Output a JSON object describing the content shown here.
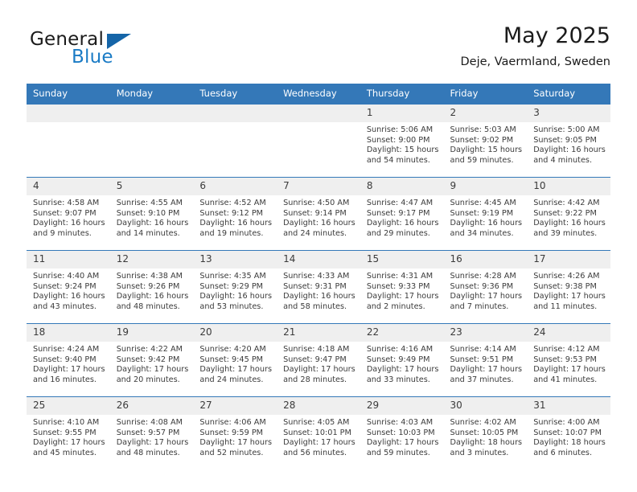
{
  "brand": {
    "name_part1": "General",
    "name_part2": "Blue",
    "logo_icon": "triangle-logo-icon",
    "accent_color": "#1a7bc5"
  },
  "header": {
    "title": "May 2025",
    "subtitle": "Deje, Vaermland, Sweden"
  },
  "theme": {
    "header_blue": "#3478b8",
    "daynum_gray": "#efefef",
    "text_color": "#3b3b3b"
  },
  "calendar": {
    "weekday_headers": [
      "Sunday",
      "Monday",
      "Tuesday",
      "Wednesday",
      "Thursday",
      "Friday",
      "Saturday"
    ],
    "weeks": [
      [
        {
          "day": "",
          "sunrise": "",
          "sunset": "",
          "daylight_line1": "",
          "daylight_line2": "",
          "empty": true
        },
        {
          "day": "",
          "sunrise": "",
          "sunset": "",
          "daylight_line1": "",
          "daylight_line2": "",
          "empty": true
        },
        {
          "day": "",
          "sunrise": "",
          "sunset": "",
          "daylight_line1": "",
          "daylight_line2": "",
          "empty": true
        },
        {
          "day": "",
          "sunrise": "",
          "sunset": "",
          "daylight_line1": "",
          "daylight_line2": "",
          "empty": true
        },
        {
          "day": "1",
          "sunrise": "Sunrise: 5:06 AM",
          "sunset": "Sunset: 9:00 PM",
          "daylight_line1": "Daylight: 15 hours",
          "daylight_line2": "and 54 minutes."
        },
        {
          "day": "2",
          "sunrise": "Sunrise: 5:03 AM",
          "sunset": "Sunset: 9:02 PM",
          "daylight_line1": "Daylight: 15 hours",
          "daylight_line2": "and 59 minutes."
        },
        {
          "day": "3",
          "sunrise": "Sunrise: 5:00 AM",
          "sunset": "Sunset: 9:05 PM",
          "daylight_line1": "Daylight: 16 hours",
          "daylight_line2": "and 4 minutes."
        }
      ],
      [
        {
          "day": "4",
          "sunrise": "Sunrise: 4:58 AM",
          "sunset": "Sunset: 9:07 PM",
          "daylight_line1": "Daylight: 16 hours",
          "daylight_line2": "and 9 minutes."
        },
        {
          "day": "5",
          "sunrise": "Sunrise: 4:55 AM",
          "sunset": "Sunset: 9:10 PM",
          "daylight_line1": "Daylight: 16 hours",
          "daylight_line2": "and 14 minutes."
        },
        {
          "day": "6",
          "sunrise": "Sunrise: 4:52 AM",
          "sunset": "Sunset: 9:12 PM",
          "daylight_line1": "Daylight: 16 hours",
          "daylight_line2": "and 19 minutes."
        },
        {
          "day": "7",
          "sunrise": "Sunrise: 4:50 AM",
          "sunset": "Sunset: 9:14 PM",
          "daylight_line1": "Daylight: 16 hours",
          "daylight_line2": "and 24 minutes."
        },
        {
          "day": "8",
          "sunrise": "Sunrise: 4:47 AM",
          "sunset": "Sunset: 9:17 PM",
          "daylight_line1": "Daylight: 16 hours",
          "daylight_line2": "and 29 minutes."
        },
        {
          "day": "9",
          "sunrise": "Sunrise: 4:45 AM",
          "sunset": "Sunset: 9:19 PM",
          "daylight_line1": "Daylight: 16 hours",
          "daylight_line2": "and 34 minutes."
        },
        {
          "day": "10",
          "sunrise": "Sunrise: 4:42 AM",
          "sunset": "Sunset: 9:22 PM",
          "daylight_line1": "Daylight: 16 hours",
          "daylight_line2": "and 39 minutes."
        }
      ],
      [
        {
          "day": "11",
          "sunrise": "Sunrise: 4:40 AM",
          "sunset": "Sunset: 9:24 PM",
          "daylight_line1": "Daylight: 16 hours",
          "daylight_line2": "and 43 minutes."
        },
        {
          "day": "12",
          "sunrise": "Sunrise: 4:38 AM",
          "sunset": "Sunset: 9:26 PM",
          "daylight_line1": "Daylight: 16 hours",
          "daylight_line2": "and 48 minutes."
        },
        {
          "day": "13",
          "sunrise": "Sunrise: 4:35 AM",
          "sunset": "Sunset: 9:29 PM",
          "daylight_line1": "Daylight: 16 hours",
          "daylight_line2": "and 53 minutes."
        },
        {
          "day": "14",
          "sunrise": "Sunrise: 4:33 AM",
          "sunset": "Sunset: 9:31 PM",
          "daylight_line1": "Daylight: 16 hours",
          "daylight_line2": "and 58 minutes."
        },
        {
          "day": "15",
          "sunrise": "Sunrise: 4:31 AM",
          "sunset": "Sunset: 9:33 PM",
          "daylight_line1": "Daylight: 17 hours",
          "daylight_line2": "and 2 minutes."
        },
        {
          "day": "16",
          "sunrise": "Sunrise: 4:28 AM",
          "sunset": "Sunset: 9:36 PM",
          "daylight_line1": "Daylight: 17 hours",
          "daylight_line2": "and 7 minutes."
        },
        {
          "day": "17",
          "sunrise": "Sunrise: 4:26 AM",
          "sunset": "Sunset: 9:38 PM",
          "daylight_line1": "Daylight: 17 hours",
          "daylight_line2": "and 11 minutes."
        }
      ],
      [
        {
          "day": "18",
          "sunrise": "Sunrise: 4:24 AM",
          "sunset": "Sunset: 9:40 PM",
          "daylight_line1": "Daylight: 17 hours",
          "daylight_line2": "and 16 minutes."
        },
        {
          "day": "19",
          "sunrise": "Sunrise: 4:22 AM",
          "sunset": "Sunset: 9:42 PM",
          "daylight_line1": "Daylight: 17 hours",
          "daylight_line2": "and 20 minutes."
        },
        {
          "day": "20",
          "sunrise": "Sunrise: 4:20 AM",
          "sunset": "Sunset: 9:45 PM",
          "daylight_line1": "Daylight: 17 hours",
          "daylight_line2": "and 24 minutes."
        },
        {
          "day": "21",
          "sunrise": "Sunrise: 4:18 AM",
          "sunset": "Sunset: 9:47 PM",
          "daylight_line1": "Daylight: 17 hours",
          "daylight_line2": "and 28 minutes."
        },
        {
          "day": "22",
          "sunrise": "Sunrise: 4:16 AM",
          "sunset": "Sunset: 9:49 PM",
          "daylight_line1": "Daylight: 17 hours",
          "daylight_line2": "and 33 minutes."
        },
        {
          "day": "23",
          "sunrise": "Sunrise: 4:14 AM",
          "sunset": "Sunset: 9:51 PM",
          "daylight_line1": "Daylight: 17 hours",
          "daylight_line2": "and 37 minutes."
        },
        {
          "day": "24",
          "sunrise": "Sunrise: 4:12 AM",
          "sunset": "Sunset: 9:53 PM",
          "daylight_line1": "Daylight: 17 hours",
          "daylight_line2": "and 41 minutes."
        }
      ],
      [
        {
          "day": "25",
          "sunrise": "Sunrise: 4:10 AM",
          "sunset": "Sunset: 9:55 PM",
          "daylight_line1": "Daylight: 17 hours",
          "daylight_line2": "and 45 minutes."
        },
        {
          "day": "26",
          "sunrise": "Sunrise: 4:08 AM",
          "sunset": "Sunset: 9:57 PM",
          "daylight_line1": "Daylight: 17 hours",
          "daylight_line2": "and 48 minutes."
        },
        {
          "day": "27",
          "sunrise": "Sunrise: 4:06 AM",
          "sunset": "Sunset: 9:59 PM",
          "daylight_line1": "Daylight: 17 hours",
          "daylight_line2": "and 52 minutes."
        },
        {
          "day": "28",
          "sunrise": "Sunrise: 4:05 AM",
          "sunset": "Sunset: 10:01 PM",
          "daylight_line1": "Daylight: 17 hours",
          "daylight_line2": "and 56 minutes."
        },
        {
          "day": "29",
          "sunrise": "Sunrise: 4:03 AM",
          "sunset": "Sunset: 10:03 PM",
          "daylight_line1": "Daylight: 17 hours",
          "daylight_line2": "and 59 minutes."
        },
        {
          "day": "30",
          "sunrise": "Sunrise: 4:02 AM",
          "sunset": "Sunset: 10:05 PM",
          "daylight_line1": "Daylight: 18 hours",
          "daylight_line2": "and 3 minutes."
        },
        {
          "day": "31",
          "sunrise": "Sunrise: 4:00 AM",
          "sunset": "Sunset: 10:07 PM",
          "daylight_line1": "Daylight: 18 hours",
          "daylight_line2": "and 6 minutes."
        }
      ]
    ]
  }
}
